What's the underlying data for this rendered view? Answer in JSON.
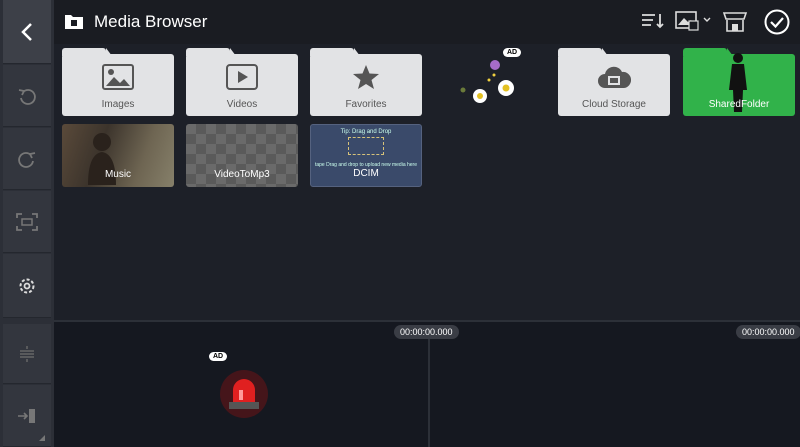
{
  "header": {
    "title": "Media Browser",
    "icons": [
      "folder-film-icon",
      "sort-icon",
      "image-filter-icon",
      "store-icon",
      "confirm-icon"
    ]
  },
  "rail": {
    "buttons": [
      "back-icon",
      "undo-icon",
      "redo-icon",
      "crop-icon",
      "settings-icon",
      "split-icon",
      "exit-icon"
    ]
  },
  "folders": [
    {
      "label": "Images",
      "icon": "image-icon"
    },
    {
      "label": "Videos",
      "icon": "play-icon"
    },
    {
      "label": "Favorites",
      "icon": "star-icon"
    },
    {
      "label": "Cloud Storage",
      "icon": "cloud-icon"
    },
    {
      "label": "SharedFolder",
      "icon": "person-icon"
    }
  ],
  "thumbs": [
    {
      "label": "Music"
    },
    {
      "label": "VideoToMp3"
    },
    {
      "label": "DCIM",
      "tip": "Tip: Drag and Drop",
      "sub": "tape Drag and drop to upload new media here"
    }
  ],
  "ads": {
    "badge": "AD"
  },
  "timeline": {
    "timecode_left": "00:00:00.000",
    "timecode_right": "00:00:00.000",
    "ad_badge": "AD"
  },
  "colors": {
    "accent_green": "#31b24a",
    "folder": "#e2e3e5",
    "background": "#1d2028"
  }
}
